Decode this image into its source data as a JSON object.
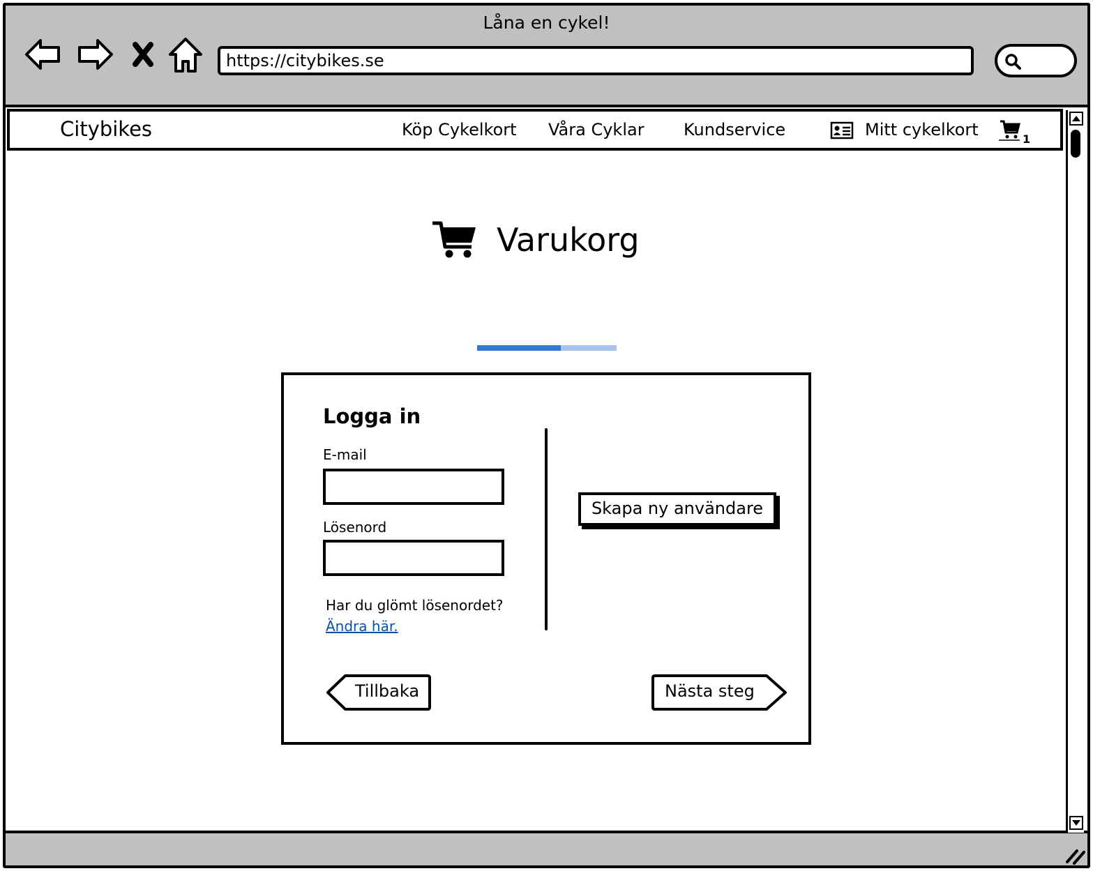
{
  "window": {
    "title": "Låna en cykel!",
    "url": "https://citybikes.se"
  },
  "icons": [
    "back-arrow-icon",
    "forward-arrow-icon",
    "close-icon",
    "home-icon",
    "search-icon",
    "id-card-icon",
    "cart-icon"
  ],
  "navbar": {
    "brand": "Citybikes",
    "links": [
      "Köp Cykelkort",
      "Våra Cyklar",
      "Kundservice"
    ],
    "account_label": "Mitt cykelkort",
    "cart_count": "1"
  },
  "page": {
    "heading": "Varukorg",
    "progress_fraction": 0.6
  },
  "login": {
    "title": "Logga in",
    "email_label": "E-mail",
    "email_value": "",
    "password_label": "Lösenord",
    "password_value": "",
    "forgot_text": "Har du glömt lösenordet?",
    "change_link": "Ändra här.",
    "create_user_button": "Skapa ny användare",
    "back_button": "Tillbaka",
    "next_button": "Nästa steg"
  },
  "colors": {
    "chrome": "#c0c0c0",
    "progress_fill": "#3275db",
    "progress_track": "#a8c4ee",
    "link": "#0b4fa0"
  }
}
